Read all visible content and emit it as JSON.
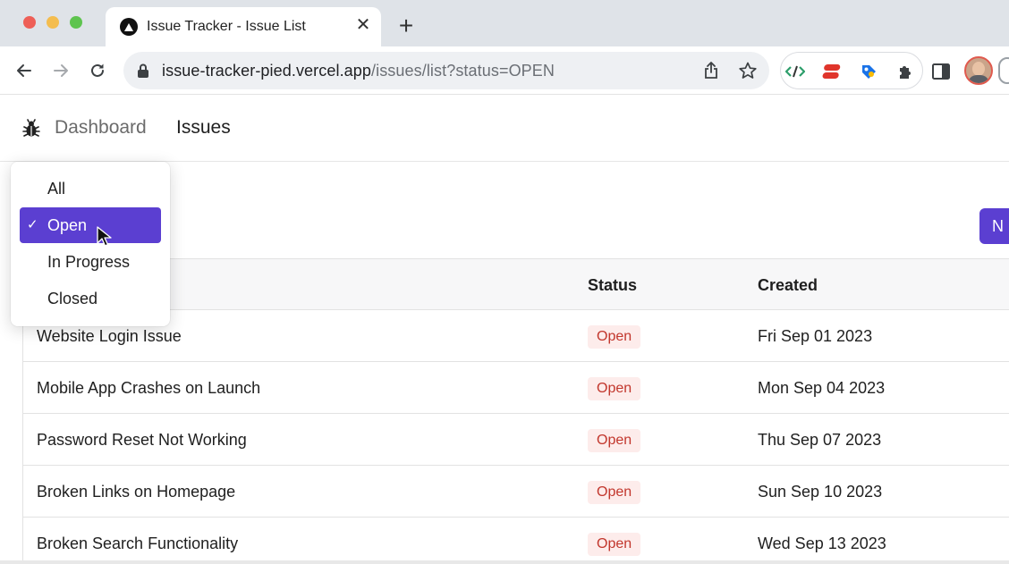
{
  "browser": {
    "tab_title": "Issue Tracker - Issue List",
    "tab_close": "✕",
    "new_tab": "+",
    "url_host": "issue-tracker-pied.vercel.app",
    "url_path": "/issues/list?status=OPEN"
  },
  "app": {
    "nav": {
      "logo_icon": "bug-icon",
      "dashboard": "Dashboard",
      "issues": "Issues"
    },
    "new_issue_button": "N",
    "status_filter": {
      "selected": "Open",
      "check": "✓",
      "options": [
        "All",
        "Open",
        "In Progress",
        "Closed"
      ]
    },
    "table": {
      "headers": {
        "status": "Status",
        "created": "Created"
      },
      "rows": [
        {
          "title": "Website Login Issue",
          "status": "Open",
          "created": "Fri Sep 01 2023"
        },
        {
          "title": "Mobile App Crashes on Launch",
          "status": "Open",
          "created": "Mon Sep 04 2023"
        },
        {
          "title": "Password Reset Not Working",
          "status": "Open",
          "created": "Thu Sep 07 2023"
        },
        {
          "title": "Broken Links on Homepage",
          "status": "Open",
          "created": "Sun Sep 10 2023"
        },
        {
          "title": "Broken Search Functionality",
          "status": "Open",
          "created": "Wed Sep 13 2023"
        }
      ]
    }
  },
  "colors": {
    "accent": "#5b3fd1",
    "badge_bg": "#fdeceb",
    "badge_text": "#c2362c"
  }
}
